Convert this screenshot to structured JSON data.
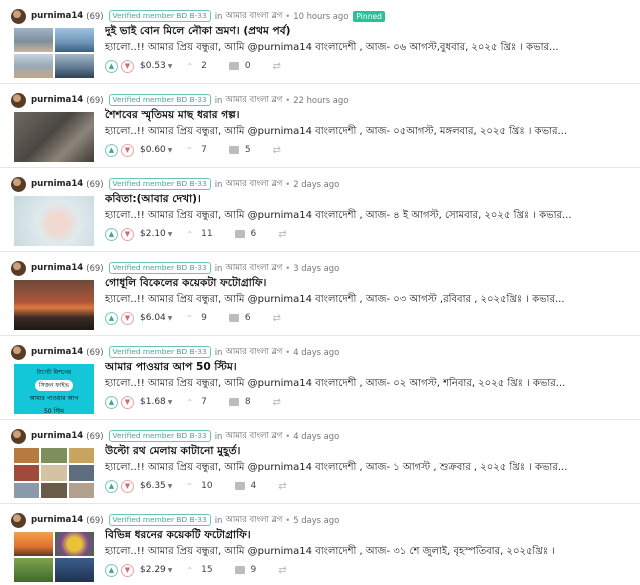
{
  "posts": [
    {
      "author": "purnima14",
      "reputation": "(69)",
      "badge": "Verified member BD B-33",
      "in_label": "in",
      "community": "আমার বাংলা ব্লগ",
      "separator": "•",
      "time": "10 hours ago",
      "pinned": "Pinned",
      "title": "দুই ভাই বোন মিলে নৌকা ভ্রমণ। (প্রথম পর্ব)",
      "excerpt": "হ্যালো..!! আমার প্রিয় বন্ধুরা, আমি @purnima14 বাংলাদেশী , আজ- ০৬ আগস্ট,বুধবার, ২০২৫ খ্রিঃ । কভার...",
      "payout": "$0.53",
      "votes": "2",
      "replies": "0"
    },
    {
      "author": "purnima14",
      "reputation": "(69)",
      "badge": "Verified member BD B-33",
      "in_label": "in",
      "community": "আমার বাংলা ব্লগ",
      "separator": "•",
      "time": "22 hours ago",
      "title": "শৈশবের স্মৃতিময় মাছ ধরার গল্প।",
      "excerpt": "হ্যালো..!! আমার প্রিয় বন্ধুরা, আমি @purnima14 বাংলাদেশী , আজ- ০৫আগস্ট, মঙ্গলবার, ২০২৫ খ্রিঃ । কভার...",
      "payout": "$0.60",
      "votes": "7",
      "replies": "5"
    },
    {
      "author": "purnima14",
      "reputation": "(69)",
      "badge": "Verified member BD B-33",
      "in_label": "in",
      "community": "আমার বাংলা ব্লগ",
      "separator": "•",
      "time": "2 days ago",
      "title": "কবিতা:(আবার দেখা)।",
      "excerpt": "হ্যালো..!! আমার প্রিয় বন্ধুরা, আমি @purnima14 বাংলাদেশী , আজ- ৪ ই আগস্ট, সোমবার, ২০২৫ খ্রিঃ । কভার...",
      "payout": "$2.10",
      "votes": "11",
      "replies": "6"
    },
    {
      "author": "purnima14",
      "reputation": "(69)",
      "badge": "Verified member BD B-33",
      "in_label": "in",
      "community": "আমার বাংলা ব্লগ",
      "separator": "•",
      "time": "3 days ago",
      "title": "গোধূলি বিকেলের কয়েকটা ফটোগ্রাফি।",
      "excerpt": "হ্যালো..!! আমার প্রিয় বন্ধুরা, আমি @purnima14 বাংলাদেশী , আজ- ০৩ আগস্ট ,রবিবার , ২০২৫খ্রিঃ । কভার...",
      "payout": "$6.04",
      "votes": "9",
      "replies": "6"
    },
    {
      "author": "purnima14",
      "reputation": "(69)",
      "badge": "Verified member BD B-33",
      "in_label": "in",
      "community": "আমার বাংলা ব্লগ",
      "separator": "•",
      "time": "4 days ago",
      "title": "আমার পাওয়ার আপ 50 স্টিম।",
      "excerpt": "হ্যালো..!! আমার প্রিয় বন্ধুরা, আমি @purnima14 বাংলাদেশী , আজ- ০২ আগস্ট, শনিবার, ২০২৫ খ্রিঃ । কভার...",
      "payout": "$1.68",
      "votes": "7",
      "replies": "8",
      "poster_lines": [
        "টার্গেট মিশনের",
        "সিজন ফাইভ",
        "আমার পাওয়ার আপ",
        "50 স্টিম"
      ]
    },
    {
      "author": "purnima14",
      "reputation": "(69)",
      "badge": "Verified member BD B-33",
      "in_label": "in",
      "community": "আমার বাংলা ব্লগ",
      "separator": "•",
      "time": "4 days ago",
      "title": "উল্টো রথ মেলায় কাটানো মুহূর্ত।",
      "excerpt": "হ্যালো..!! আমার প্রিয় বন্ধুরা, আমি @purnima14 বাংলাদেশী , আজ- ১ আগস্ট , শুক্রবার , ২০২৫ খ্রিঃ । কভার...",
      "payout": "$6.35",
      "votes": "10",
      "replies": "4"
    },
    {
      "author": "purnima14",
      "reputation": "(69)",
      "badge": "Verified member BD B-33",
      "in_label": "in",
      "community": "আমার বাংলা ব্লগ",
      "separator": "•",
      "time": "5 days ago",
      "title": "বিভিন্ন ধরনের কয়েকটি ফটোগ্রাফি।",
      "excerpt": "হ্যালো..!! আমার প্রিয় বন্ধুরা, আমি @purnima14 বাংলাদেশী , আজ- ৩১ শে জুলাই, বৃহস্পতিবার, ২০২৫খ্রিঃ ।",
      "payout": "$2.29",
      "votes": "15",
      "replies": "9"
    }
  ],
  "icons": {
    "upvote": "chevron-up-icon",
    "downvote": "chevron-down-icon",
    "payout_dropdown": "caret-down-icon",
    "votes": "vote-count-icon",
    "replies": "comment-icon",
    "resteem": "resteem-icon"
  },
  "colors": {
    "pinned_bg": "#28c19a",
    "badge_border": "#6bc4b8",
    "upvote": "#3aa98f",
    "downvote": "#d46b6b",
    "poster_bg": "#13c7d9"
  }
}
